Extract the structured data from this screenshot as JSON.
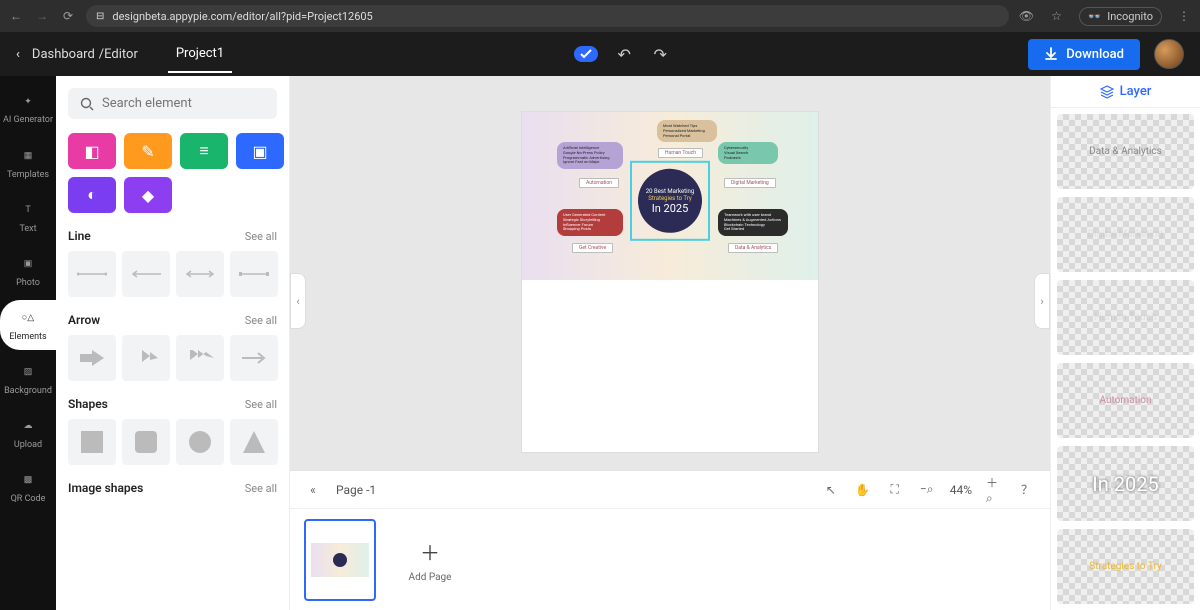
{
  "browser": {
    "url": "designbeta.appypie.com/editor/all?pid=Project12605",
    "incognito_label": "Incognito"
  },
  "header": {
    "crumb1": "Dashboard",
    "crumb2": "/Editor",
    "project_tab": "Project1",
    "download_label": "Download"
  },
  "rail": {
    "ai": "AI Generator",
    "templates": "Templates",
    "text": "Text",
    "photo": "Photo",
    "elements": "Elements",
    "background": "Background",
    "upload": "Upload",
    "qrcode": "QR Code"
  },
  "panel": {
    "search_placeholder": "Search element",
    "line_title": "Line",
    "arrow_title": "Arrow",
    "shapes_title": "Shapes",
    "image_shapes_title": "Image shapes",
    "see_all": "See all"
  },
  "canvas": {
    "center_l1": "20 Best Marketing",
    "center_l2": "Strategies to Try",
    "center_l3": "In 2025",
    "tag_human": "Human Touch",
    "tag_auto": "Automation",
    "tag_dm": "Digital Marketing",
    "tag_gc": "Get Creative",
    "tag_da": "Data & Analytics"
  },
  "bottom": {
    "page_label": "Page -1",
    "zoom": "44%",
    "add_page": "Add Page"
  },
  "layers": {
    "title": "Layer",
    "items": [
      "Data & Analytics",
      "Digital Marketing",
      "Human Touch",
      "Automation",
      "In 2025",
      "Strategies to Try"
    ]
  }
}
